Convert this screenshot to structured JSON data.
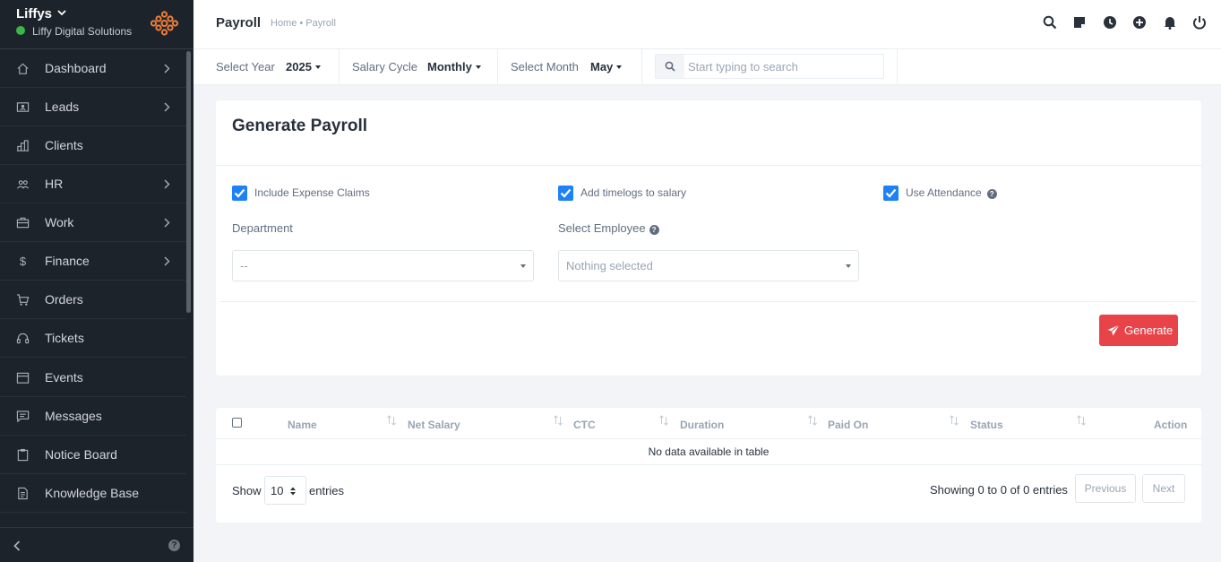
{
  "sidebar": {
    "brand": {
      "name": "Liffys",
      "company": "Liffy Digital Solutions",
      "status_color": "#39b54a",
      "logo_color": "#f07f3c"
    },
    "items": [
      {
        "label": "Dashboard",
        "icon": "home-icon",
        "has_submenu": true
      },
      {
        "label": "Leads",
        "icon": "user-card-icon",
        "has_submenu": true
      },
      {
        "label": "Clients",
        "icon": "building-icon",
        "has_submenu": false
      },
      {
        "label": "HR",
        "icon": "people-icon",
        "has_submenu": true
      },
      {
        "label": "Work",
        "icon": "briefcase-icon",
        "has_submenu": true
      },
      {
        "label": "Finance",
        "icon": "dollar-icon",
        "has_submenu": true
      },
      {
        "label": "Orders",
        "icon": "cart-icon",
        "has_submenu": false
      },
      {
        "label": "Tickets",
        "icon": "headset-icon",
        "has_submenu": false
      },
      {
        "label": "Events",
        "icon": "calendar-icon",
        "has_submenu": false
      },
      {
        "label": "Messages",
        "icon": "chat-icon",
        "has_submenu": false
      },
      {
        "label": "Notice Board",
        "icon": "clipboard-icon",
        "has_submenu": false
      },
      {
        "label": "Knowledge Base",
        "icon": "document-icon",
        "has_submenu": false
      }
    ],
    "help_glyph": "?"
  },
  "header": {
    "title": "Payroll",
    "breadcrumb": "Home • Payroll",
    "icons": [
      "search-icon",
      "sticky-note-icon",
      "clock-icon",
      "plus-circle-icon",
      "bell-icon",
      "power-icon"
    ]
  },
  "filters": {
    "year": {
      "label": "Select Year",
      "value": "2025"
    },
    "cycle": {
      "label": "Salary Cycle",
      "value": "Monthly"
    },
    "month": {
      "label": "Select Month",
      "value": "May"
    },
    "search": {
      "placeholder": "Start typing to search",
      "value": ""
    }
  },
  "generate": {
    "title": "Generate Payroll",
    "checkboxes": [
      {
        "label": "Include Expense Claims",
        "checked": true
      },
      {
        "label": "Add timelogs to salary",
        "checked": true
      },
      {
        "label": "Use Attendance",
        "checked": true
      }
    ],
    "department": {
      "label": "Department",
      "value": "--"
    },
    "employee": {
      "label": "Select Employee",
      "value": "Nothing selected"
    },
    "button": "Generate",
    "button_color": "#e9434a"
  },
  "table": {
    "columns": [
      "Name",
      "Net Salary",
      "CTC",
      "Duration",
      "Paid On",
      "Status",
      "Action"
    ],
    "empty_message": "No data available in table",
    "show_label": "Show",
    "page_length": "10",
    "entries_label": "entries",
    "info": "Showing 0 to 0 of 0 entries",
    "prev": "Previous",
    "next": "Next"
  },
  "colors": {
    "accent": "#1d82f5",
    "sidebar_bg": "#1d232b"
  }
}
